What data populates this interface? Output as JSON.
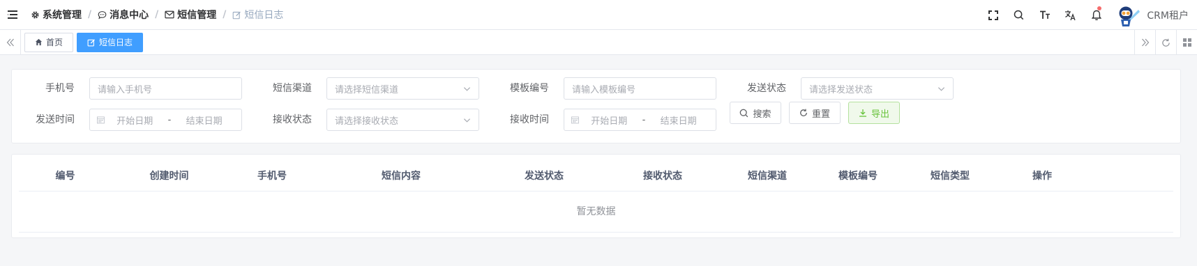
{
  "breadcrumb": [
    {
      "label": "系统管理",
      "icon": "gear-icon"
    },
    {
      "label": "消息中心",
      "icon": "chat-bubble-icon"
    },
    {
      "label": "短信管理",
      "icon": "envelope-icon"
    },
    {
      "label": "短信日志",
      "icon": "edit-icon"
    }
  ],
  "header": {
    "user_name": "CRM租户",
    "icons": [
      "fullscreen-icon",
      "search-icon",
      "font-size-icon",
      "translate-icon",
      "bell-icon"
    ]
  },
  "tags": [
    {
      "label": "首页",
      "icon": "home-icon",
      "active": false
    },
    {
      "label": "短信日志",
      "icon": "edit-icon",
      "active": true
    }
  ],
  "search": {
    "mobile": {
      "label": "手机号",
      "placeholder": "请输入手机号"
    },
    "channel": {
      "label": "短信渠道",
      "placeholder": "请选择短信渠道"
    },
    "template": {
      "label": "模板编号",
      "placeholder": "请输入模板编号"
    },
    "send_status": {
      "label": "发送状态",
      "placeholder": "请选择发送状态"
    },
    "send_time": {
      "label": "发送时间",
      "start": "开始日期",
      "sep": "-",
      "end": "结束日期"
    },
    "receive_status": {
      "label": "接收状态",
      "placeholder": "请选择接收状态"
    },
    "receive_time": {
      "label": "接收时间",
      "start": "开始日期",
      "sep": "-",
      "end": "结束日期"
    },
    "search_button": "搜索",
    "reset_button": "重置",
    "export_button": "导出"
  },
  "table": {
    "columns": [
      "编号",
      "创建时间",
      "手机号",
      "短信内容",
      "发送状态",
      "接收状态",
      "短信渠道",
      "模板编号",
      "短信类型",
      "操作"
    ],
    "empty_text": "暂无数据"
  },
  "colors": {
    "primary": "#409eff",
    "success": "#67c23a",
    "danger": "#f56c6c"
  }
}
